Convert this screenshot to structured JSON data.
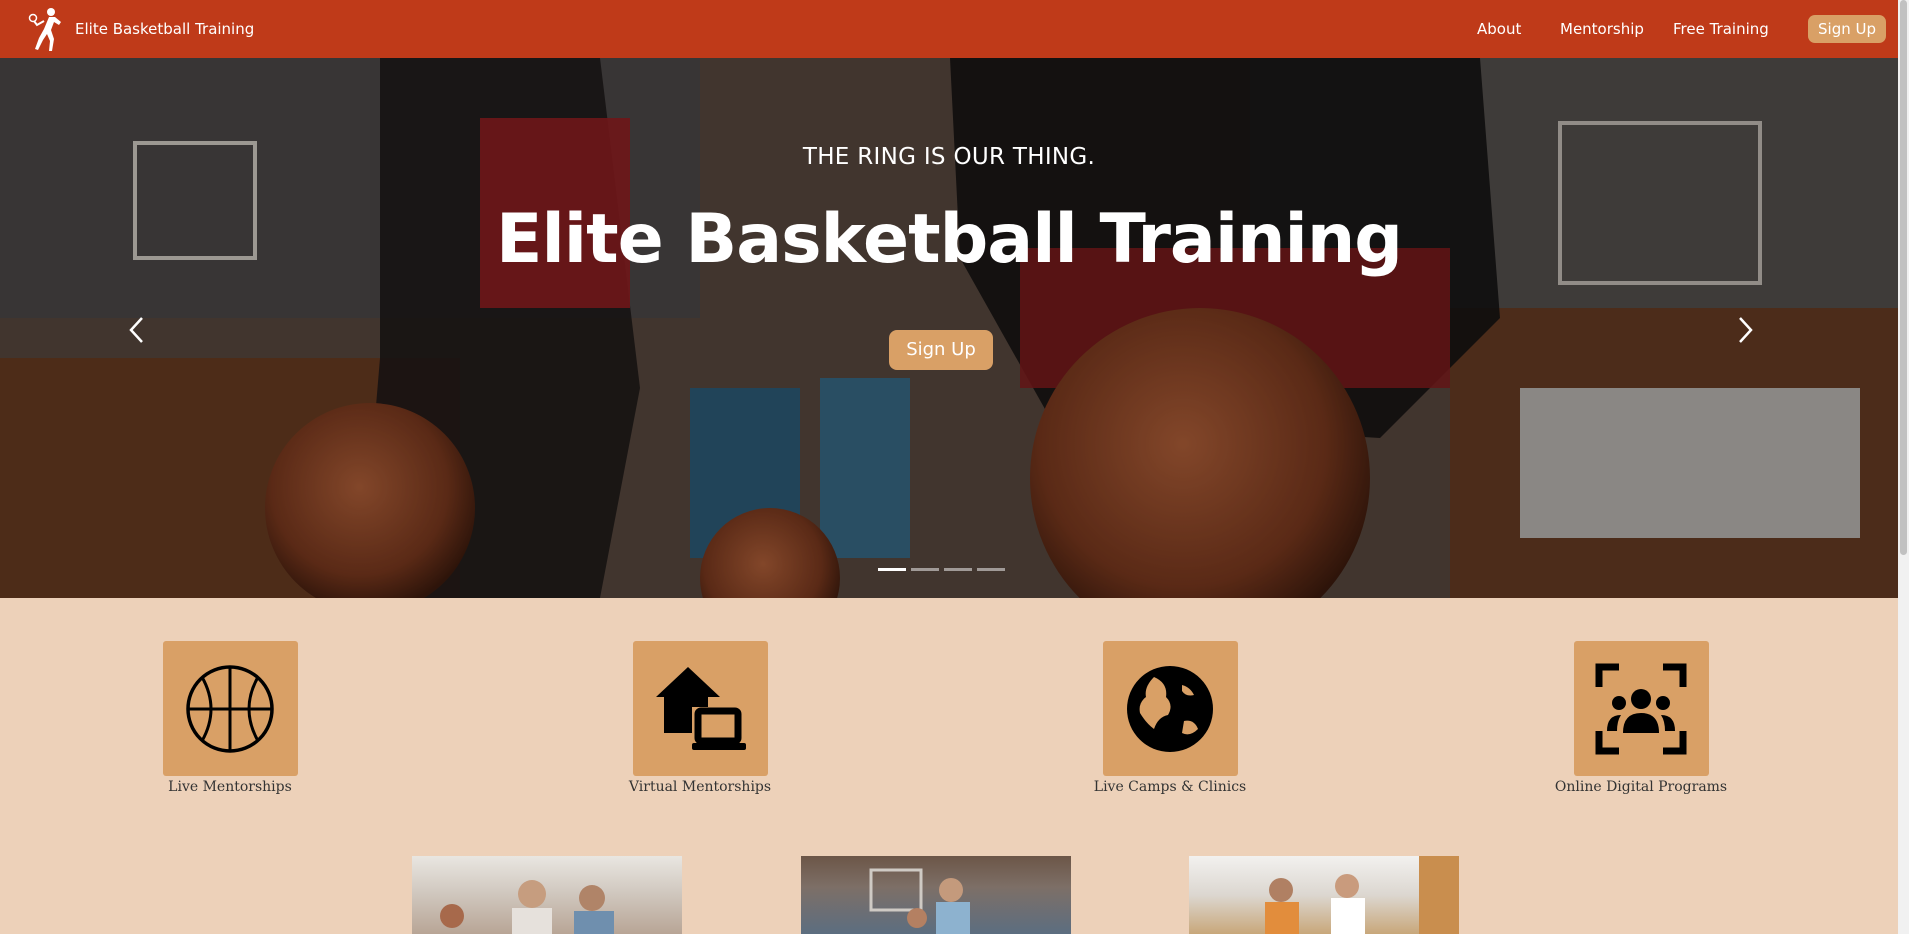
{
  "navbar": {
    "brand": "Elite Basketball Training",
    "logo_icon": "basketball-player-icon",
    "links": {
      "about": "About",
      "mentorship": "Mentorship",
      "free_training": "Free Training",
      "sign_up": "Sign Up"
    },
    "colors": {
      "background": "#bf3a19",
      "button": "#d9a066"
    }
  },
  "hero": {
    "tagline": "THE RING IS OUR THING.",
    "title": "Elite Basketball Training",
    "cta": "Sign Up",
    "slide_count": 4,
    "active_slide": 1
  },
  "services": [
    {
      "label": "Live Mentorships",
      "icon": "basketball-icon"
    },
    {
      "label": "Virtual Mentorships",
      "icon": "home-laptop-icon"
    },
    {
      "label": "Live Camps & Clinics",
      "icon": "globe-icon"
    },
    {
      "label": "Online Digital Programs",
      "icon": "group-focus-icon"
    }
  ],
  "colors": {
    "page_background": "#edd1b9",
    "tile": "#d9a066"
  }
}
